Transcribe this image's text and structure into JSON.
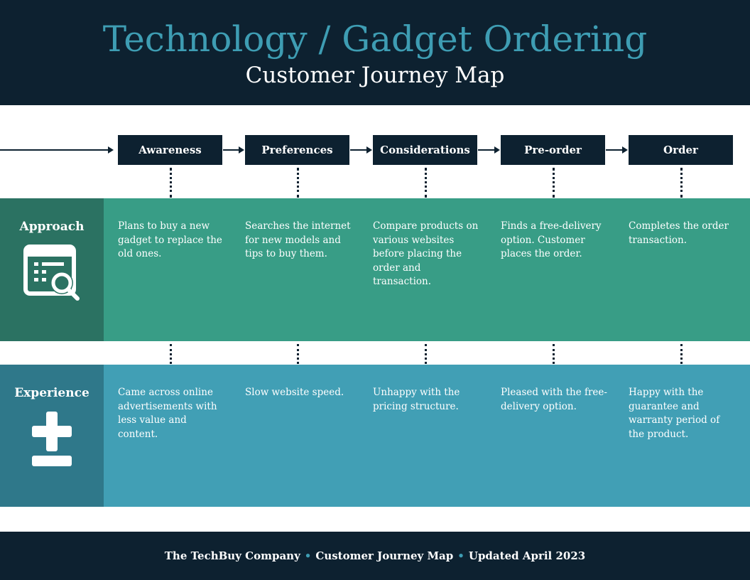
{
  "header": {
    "title": "Technology / Gadget Ordering",
    "subtitle": "Customer Journey Map"
  },
  "stages": [
    "Awareness",
    "Preferences",
    "Considerations",
    "Pre-order",
    "Order"
  ],
  "rows": [
    {
      "label": "Approach",
      "icon": "spreadsheet-search-icon",
      "color": "#389d86",
      "label_color": "#2b7262",
      "cells": [
        "Plans to buy a new gadget to replace the old ones.",
        "Searches the internet for new models and tips to buy them.",
        "Compare products on various websites before placing the order and transaction.",
        "Finds a free-delivery option. Customer places the order.",
        "Completes the order transaction."
      ]
    },
    {
      "label": "Experience",
      "icon": "plus-minus-icon",
      "color": "#419fb5",
      "label_color": "#2f788a",
      "cells": [
        "Came across online advertisements with less value and content.",
        "Slow website speed.",
        "Unhappy with the pricing structure.",
        "Pleased with the free-delivery option.",
        "Happy with the guarantee and warranty period of the product."
      ]
    }
  ],
  "footer": {
    "company": "The TechBuy Company",
    "title": "Customer Journey Map",
    "updated": "Updated April 2023"
  }
}
